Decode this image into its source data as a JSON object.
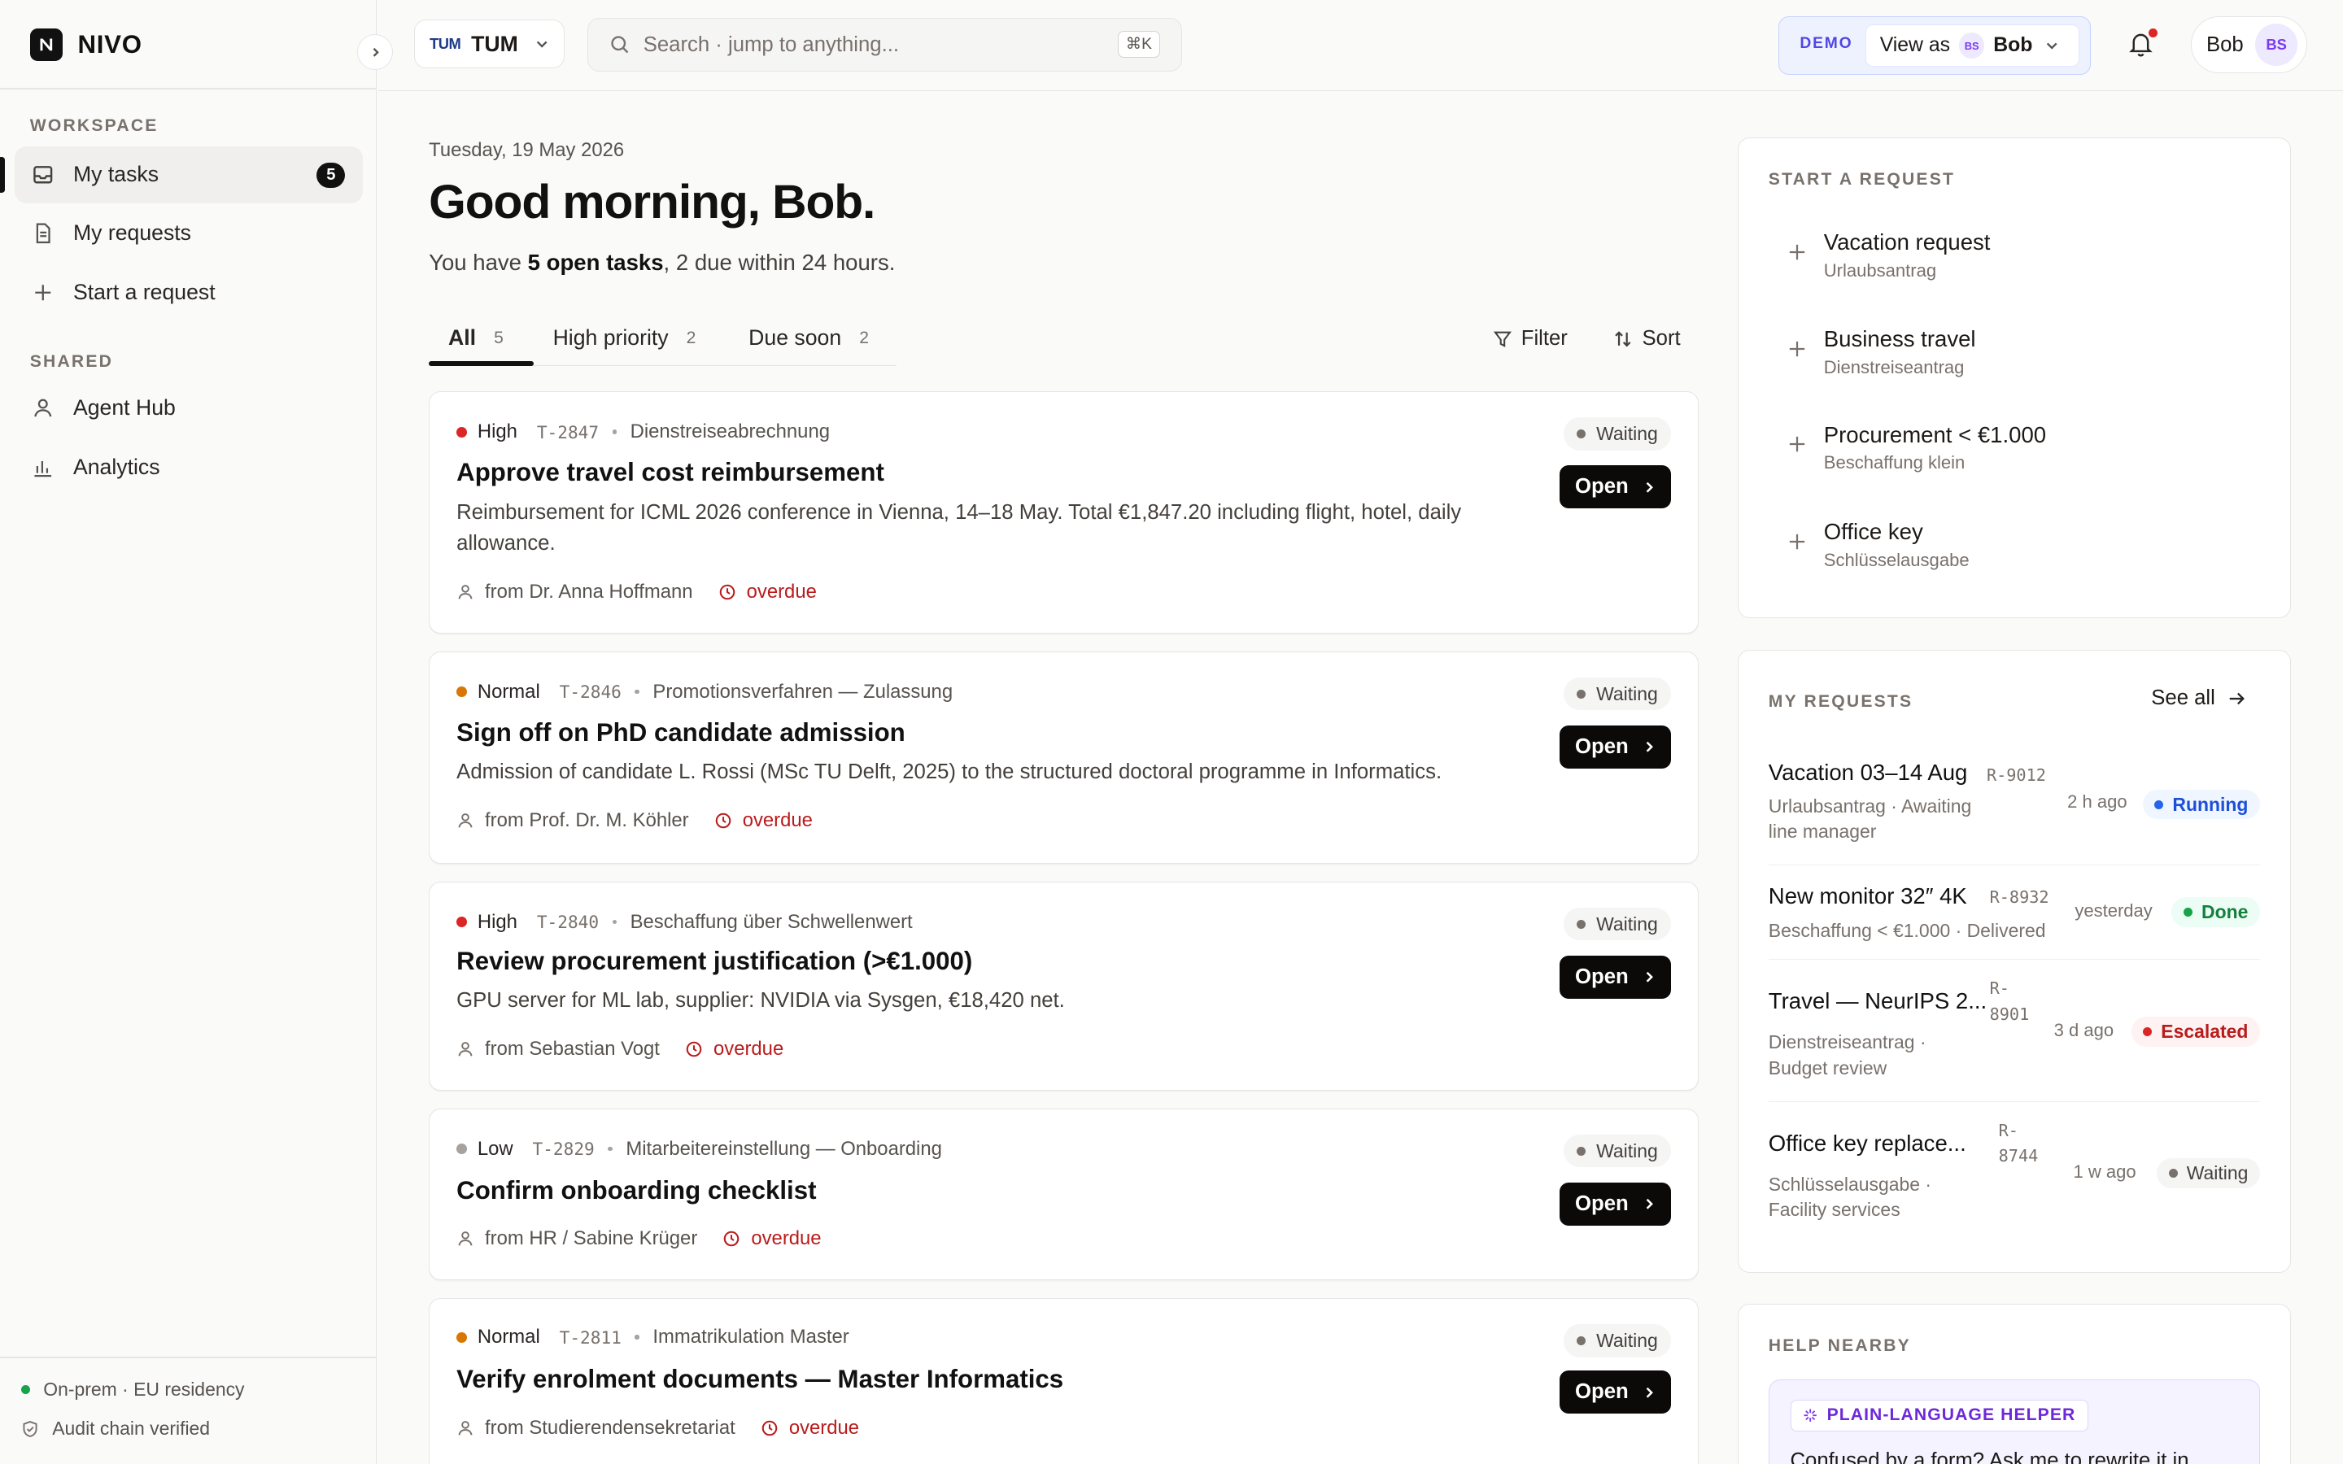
{
  "brand": {
    "name": "NIVO"
  },
  "sidebar": {
    "workspace_label": "WORKSPACE",
    "shared_label": "SHARED",
    "items": [
      {
        "label": "My tasks",
        "badge": "5",
        "icon": "inbox-icon"
      },
      {
        "label": "My requests",
        "icon": "document-icon"
      },
      {
        "label": "Start a request",
        "icon": "plus-icon"
      },
      {
        "label": "Agent Hub",
        "icon": "user-icon"
      },
      {
        "label": "Analytics",
        "icon": "bar-chart-icon"
      }
    ],
    "footer": {
      "residency": "On-prem · EU residency",
      "audit": "Audit chain verified"
    }
  },
  "header": {
    "tenant": "TUM",
    "tenant_mark": "TUM",
    "search_placeholder": "Search · jump to anything...",
    "shortcut": "⌘K",
    "demo": "DEMO",
    "view_as_label": "View as",
    "view_as_initials": "BS",
    "view_as_user": "Bob",
    "user_name": "Bob",
    "user_initials": "BS"
  },
  "main": {
    "date": "Tuesday, 19 May 2026",
    "greeting": "Good morning, Bob.",
    "summary": {
      "prefix": "You have ",
      "bold": "5 open tasks",
      "suffix": ", 2 due within 24 hours."
    },
    "tabs": [
      {
        "label": "All",
        "count": "5"
      },
      {
        "label": "High priority",
        "count": "2"
      },
      {
        "label": "Due soon",
        "count": "2"
      }
    ],
    "filter_label": "Filter",
    "sort_label": "Sort",
    "open_label": "Open",
    "tasks": [
      {
        "priority": "High",
        "priority_color": "#dc2626",
        "id": "T-2847",
        "category": "Dienstreiseabrechnung",
        "title": "Approve travel cost reimbursement",
        "description": "Reimbursement for ICML 2026 conference in Vienna, 14–18 May. Total €1,847.20 including flight, hotel, daily allowance.",
        "from": "from Dr. Anna Hoffmann",
        "due": "overdue",
        "status": "Waiting"
      },
      {
        "priority": "Normal",
        "priority_color": "#d97706",
        "id": "T-2846",
        "category": "Promotionsverfahren — Zulassung",
        "title": "Sign off on PhD candidate admission",
        "description": "Admission of candidate L. Rossi (MSc TU Delft, 2025) to the structured doctoral programme in Informatics.",
        "from": "from Prof. Dr. M. Köhler",
        "due": "overdue",
        "status": "Waiting"
      },
      {
        "priority": "High",
        "priority_color": "#dc2626",
        "id": "T-2840",
        "category": "Beschaffung über Schwellenwert",
        "title": "Review procurement justification (>€1.000)",
        "description": "GPU server for ML lab, supplier: NVIDIA via Sysgen, €18,420 net.",
        "from": "from Sebastian Vogt",
        "due": "overdue",
        "status": "Waiting"
      },
      {
        "priority": "Low",
        "priority_color": "#a8a29e",
        "id": "T-2829",
        "category": "Mitarbeitereinstellung — Onboarding",
        "title": "Confirm onboarding checklist",
        "description": "",
        "from": "from HR / Sabine Krüger",
        "due": "overdue",
        "status": "Waiting"
      },
      {
        "priority": "Normal",
        "priority_color": "#d97706",
        "id": "T-2811",
        "category": "Immatrikulation Master",
        "title": "Verify enrolment documents — Master Informatics",
        "description": "",
        "from": "from Studierendensekretariat",
        "due": "overdue",
        "status": "Waiting"
      }
    ]
  },
  "right": {
    "start_label": "START A REQUEST",
    "start_items": [
      {
        "title": "Vacation request",
        "subtitle": "Urlaubsantrag"
      },
      {
        "title": "Business travel",
        "subtitle": "Dienstreiseantrag"
      },
      {
        "title": "Procurement < €1.000",
        "subtitle": "Beschaffung klein"
      },
      {
        "title": "Office key",
        "subtitle": "Schlüsselausgabe"
      }
    ],
    "requests_label": "MY REQUESTS",
    "see_all": "See all",
    "requests": [
      {
        "title": "Vacation 03–14 Aug",
        "id": "R-9012",
        "sub1": "Urlaubsantrag · Awaiting",
        "sub2": "line manager",
        "time": "2 h ago",
        "status": "Running",
        "status_bg": "#eff6ff",
        "status_fg": "#1d4ed8",
        "status_dot": "#2563eb"
      },
      {
        "title": "New monitor 32″ 4K",
        "id": "R-8932",
        "sub1": "Beschaffung < €1.000 · Delivered",
        "sub2": "",
        "time": "yesterday",
        "status": "Done",
        "status_bg": "#ecfdf5",
        "status_fg": "#15803d",
        "status_dot": "#16a34a"
      },
      {
        "title": "Travel — NeurIPS 2...",
        "id_a": "R-",
        "id_b": "8901",
        "sub1": "Dienstreiseantrag ·",
        "sub2": "Budget review",
        "time": "3 d ago",
        "status": "Escalated",
        "status_bg": "#fef2f2",
        "status_fg": "#b91c1c",
        "status_dot": "#dc2626"
      },
      {
        "title": "Office key replace...",
        "id_a": "R-",
        "id_b": "8744",
        "sub1": "Schlüsselausgabe ·",
        "sub2": "Facility services",
        "time": "1 w ago",
        "status": "Waiting",
        "status_bg": "#f5f5f4",
        "status_fg": "#44403c",
        "status_dot": "#78716c"
      }
    ],
    "help_label": "HELP NEARBY",
    "helper_tag": "PLAIN-LANGUAGE HELPER",
    "helper_text": "Confused by a form? Ask me to rewrite it in"
  }
}
